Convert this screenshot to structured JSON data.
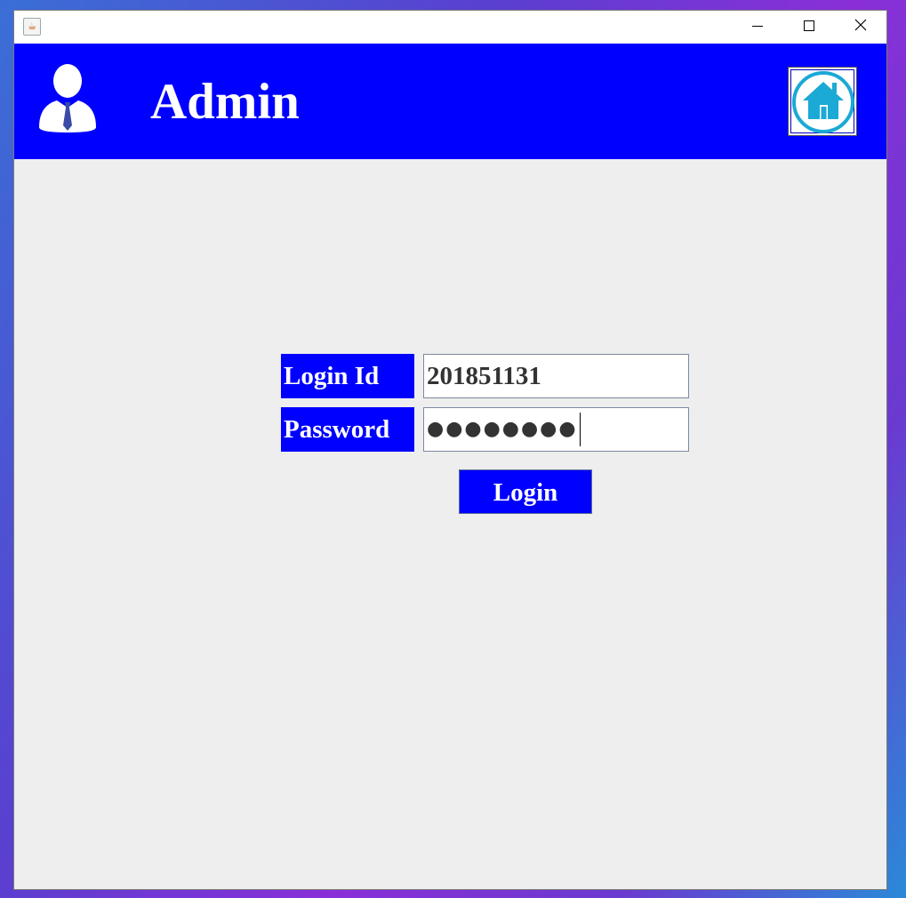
{
  "window": {
    "icon": "java-coffee-icon",
    "controls": [
      "minimize-icon",
      "maximize-icon",
      "close-icon"
    ]
  },
  "header": {
    "title": "Admin",
    "user_icon": "user-tie-icon",
    "home_icon": "home-icon",
    "color": "#0000ff"
  },
  "form": {
    "login_id_label": "Login Id",
    "login_id_value": "201851131",
    "password_label": "Password",
    "password_value": "●●●●●●●●",
    "login_button": "Login"
  },
  "colors": {
    "accent": "#0000ff",
    "background": "#eeeeee",
    "home_icon_color": "#1ba9d6"
  }
}
